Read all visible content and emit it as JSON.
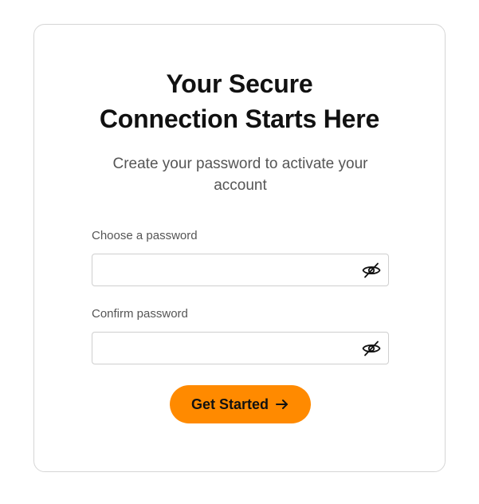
{
  "form": {
    "title_line1": "Your Secure",
    "title_line2": "Connection Starts Here",
    "subtitle": "Create your password to activate your account",
    "password": {
      "label": "Choose a password",
      "value": "",
      "placeholder": "",
      "toggle_icon": "eye-off-icon"
    },
    "confirm": {
      "label": "Confirm password",
      "value": "",
      "placeholder": "",
      "toggle_icon": "eye-off-icon"
    },
    "submit": {
      "label": "Get Started",
      "icon": "arrow-right-icon"
    }
  },
  "colors": {
    "accent": "#ff8a00",
    "text_primary": "#111111",
    "text_secondary": "#555555",
    "border": "#cfcfcf"
  }
}
